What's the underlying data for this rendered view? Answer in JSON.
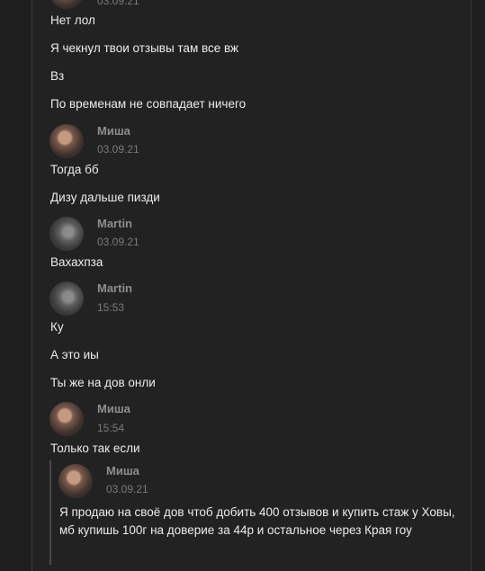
{
  "messages": {
    "m0_date": "03.09.21",
    "m0_lines": [
      "Нет лол",
      "Я чекнул твои отзывы там все вж",
      "Вз",
      "По временам не совпадает ничего"
    ],
    "m1_author": "Миша",
    "m1_date": "03.09.21",
    "m1_lines": [
      "Тогда бб",
      "Дизу дальше пизди"
    ],
    "m2_author": "Martin",
    "m2_date": "03.09.21",
    "m2_lines": [
      "Вахахпза"
    ],
    "m3_author": "Martin",
    "m3_date": "15:53",
    "m3_lines": [
      "Ку",
      "А это иы",
      "Ты же на дов онли"
    ],
    "m4_author": "Миша",
    "m4_date": "15:54",
    "m4_lines": [
      "Только так если"
    ]
  },
  "quote": {
    "author": "Миша",
    "date": "03.09.21",
    "text": "Я продаю на своё дов чтоб добить 400 отзывов и купить стаж у Ховы, мб купишь 100г на доверие за 44р и остальное через Края гоу"
  }
}
